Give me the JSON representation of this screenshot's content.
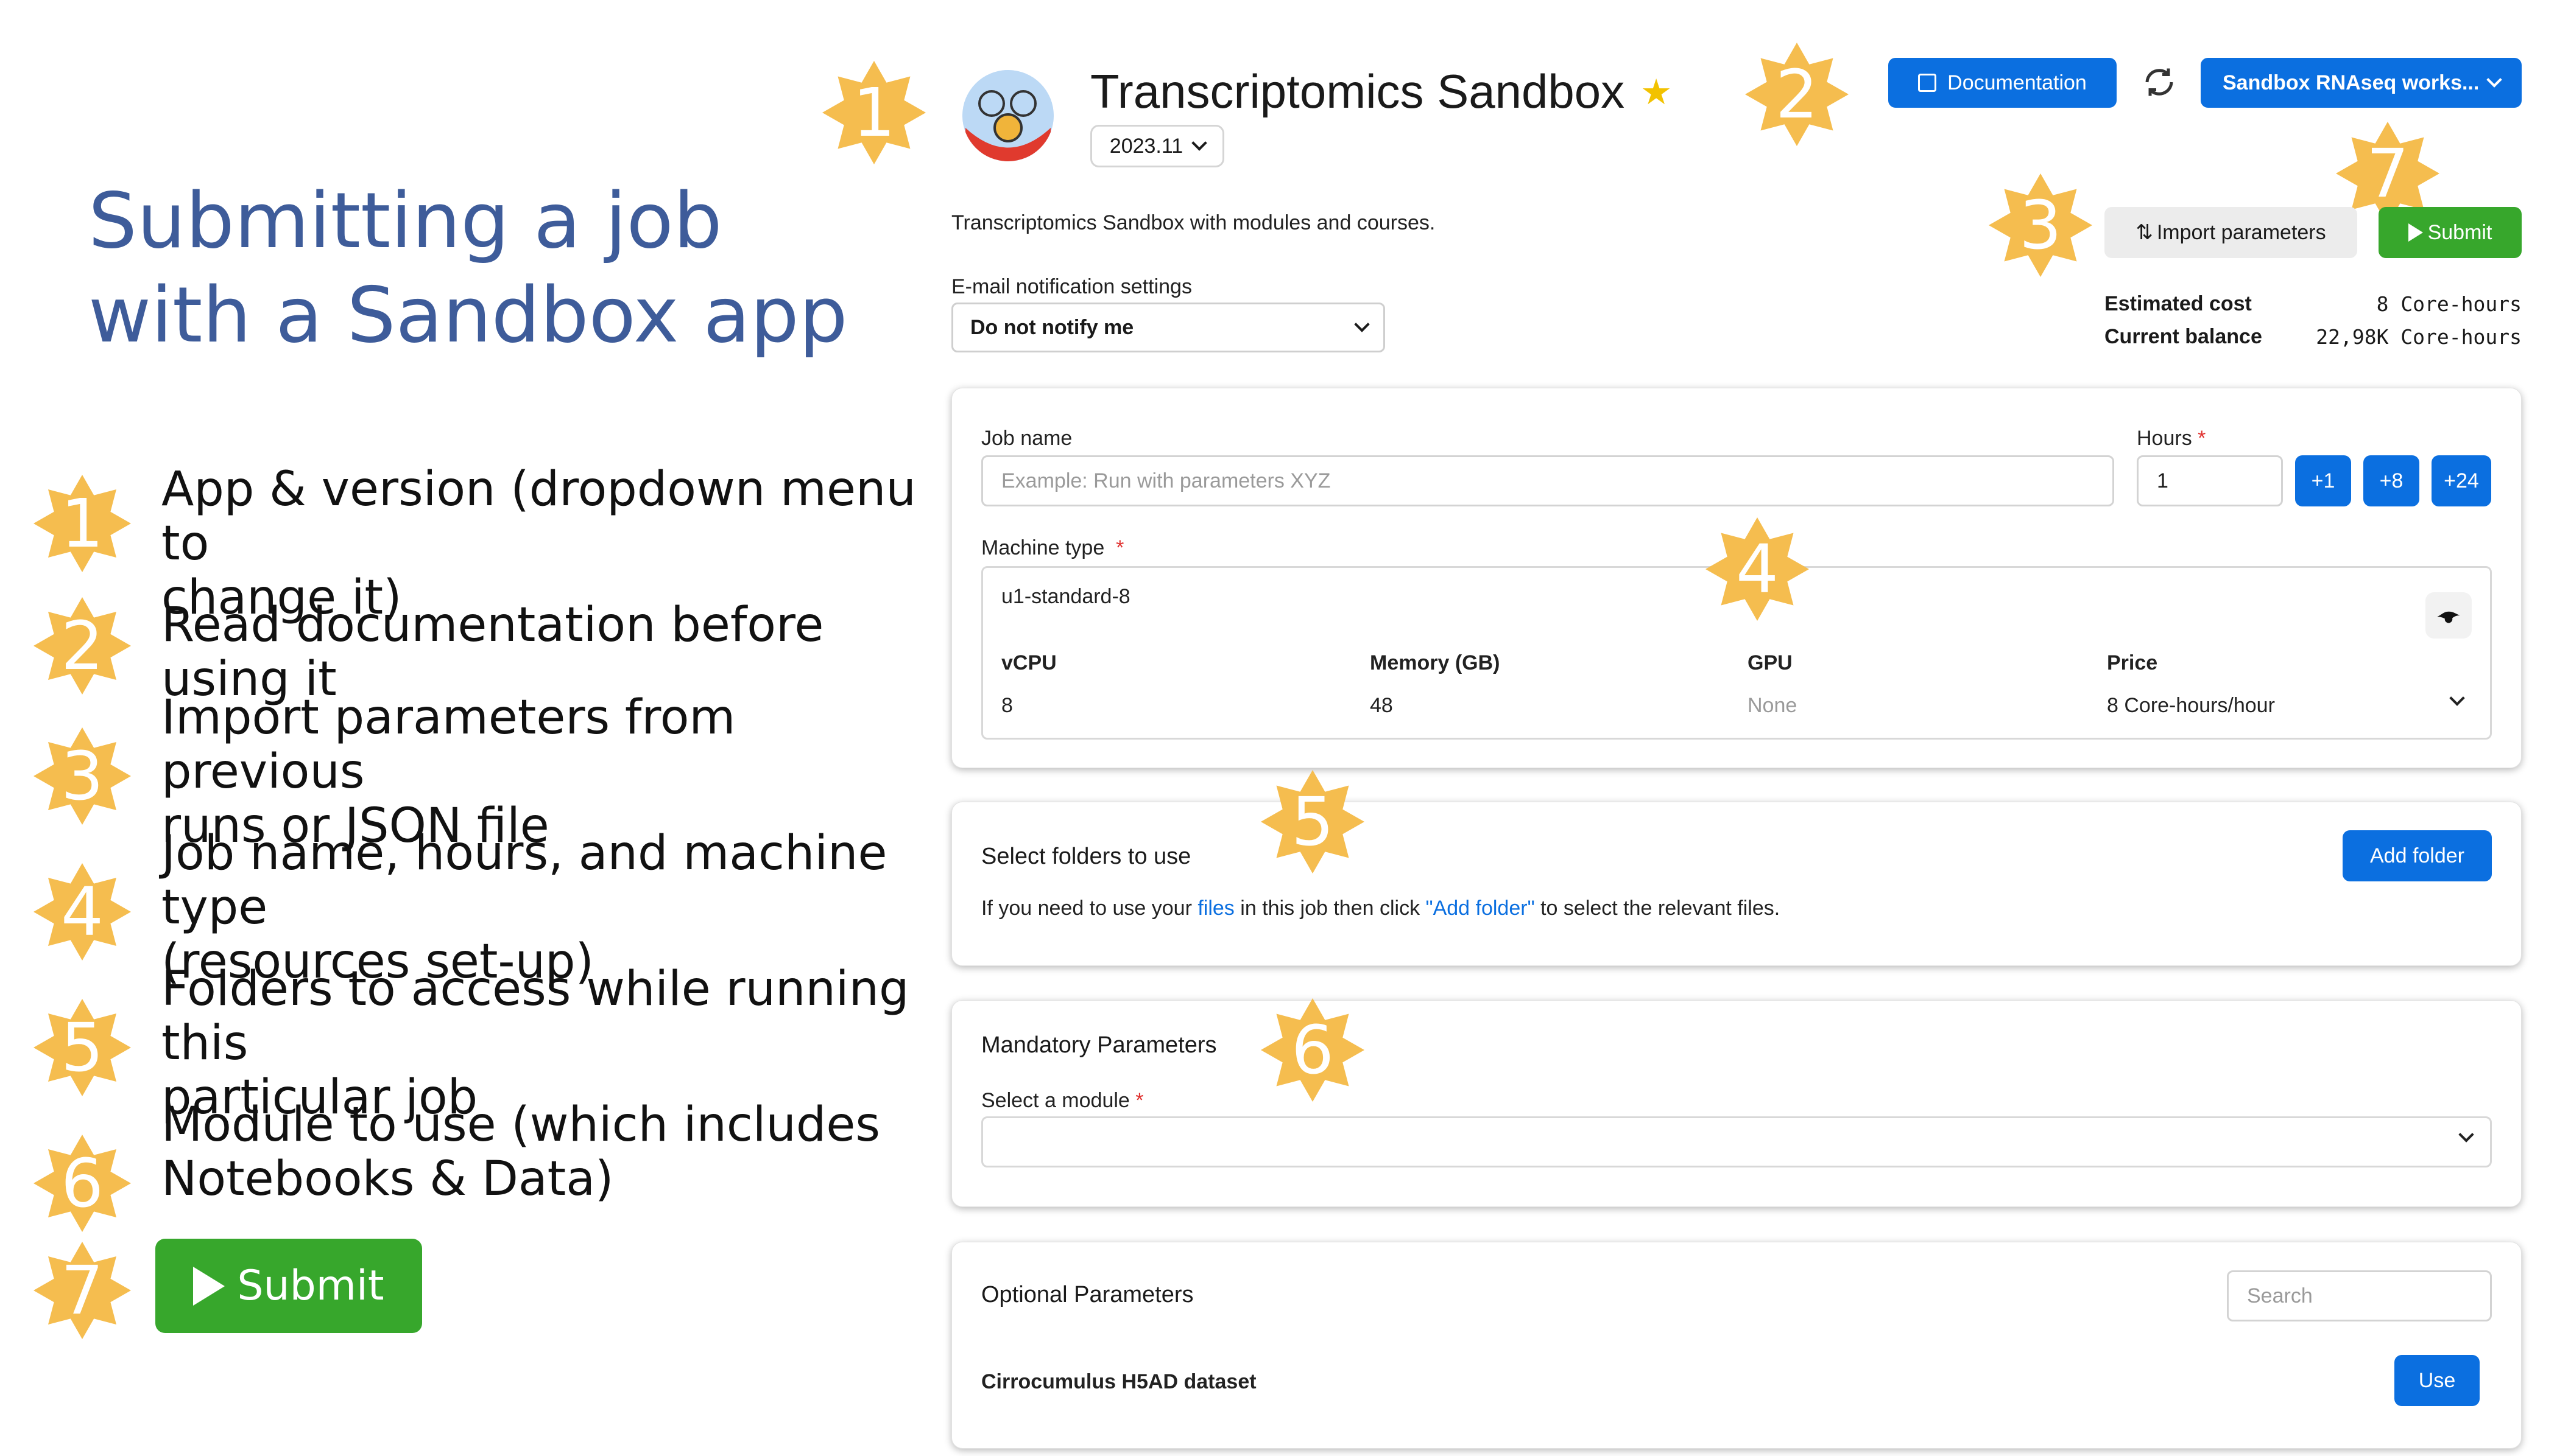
{
  "title": {
    "line1": "Submitting a job",
    "line2": "with a Sandbox app"
  },
  "legend": [
    {
      "num": "1",
      "line1": "App & version (dropdown menu to",
      "line2": "change it)"
    },
    {
      "num": "2",
      "line1": "Read documentation before using it",
      "line2": ""
    },
    {
      "num": "3",
      "line1": "Import parameters from previous",
      "line2": "runs or JSON file"
    },
    {
      "num": "4",
      "line1": "Job name, hours, and machine type",
      "line2": "(resources set-up)"
    },
    {
      "num": "5",
      "line1": "Folders to access while running this",
      "line2": "particular job"
    },
    {
      "num": "6",
      "line1": "Module to use (which includes",
      "line2": "Notebooks & Data)"
    },
    {
      "num": "7",
      "line1": "",
      "line2": ""
    }
  ],
  "legend_submit": "Submit",
  "markers": [
    "1",
    "2",
    "3",
    "7",
    "4",
    "5",
    "6"
  ],
  "app": {
    "name": "Transcriptomics Sandbox",
    "version": "2023.11",
    "description": "Transcriptomics Sandbox with modules and courses."
  },
  "header": {
    "documentation": "Documentation",
    "workspace": "Sandbox RNAseq works...",
    "import_parameters": "Import parameters",
    "submit": "Submit"
  },
  "notifications": {
    "label": "E-mail notification settings",
    "value": "Do not notify me"
  },
  "cost": {
    "estimated_label": "Estimated cost",
    "estimated_value": "8 Core-hours",
    "balance_label": "Current balance",
    "balance_value": "22,98K Core-hours"
  },
  "job": {
    "name_label": "Job name",
    "name_placeholder": "Example: Run with parameters XYZ",
    "hours_label": "Hours",
    "hours_value": "1",
    "hour_buttons": [
      "+1",
      "+8",
      "+24"
    ],
    "machine_label": "Machine type",
    "machine_value": "u1-standard-8",
    "specs": {
      "vcpu_label": "vCPU",
      "vcpu": "8",
      "memory_label": "Memory (GB)",
      "memory": "48",
      "gpu_label": "GPU",
      "gpu": "None",
      "price_label": "Price",
      "price": "8 Core-hours/hour"
    }
  },
  "folders": {
    "title": "Select folders to use",
    "add": "Add folder",
    "text_pre": "If you need to use your ",
    "text_link1": "files",
    "text_mid": " in this job then click ",
    "text_link2": "\"Add folder\"",
    "text_post": " to select the relevant files."
  },
  "mandatory": {
    "title": "Mandatory Parameters",
    "module_label": "Select a module"
  },
  "optional": {
    "title": "Optional Parameters",
    "search_placeholder": "Search",
    "dataset": "Cirrocumulus H5AD dataset",
    "use": "Use"
  },
  "colors": {
    "accent": "#0b6fe0",
    "marker": "#f5bd4f",
    "submit": "#37a72c",
    "title": "#3e5c9a"
  }
}
